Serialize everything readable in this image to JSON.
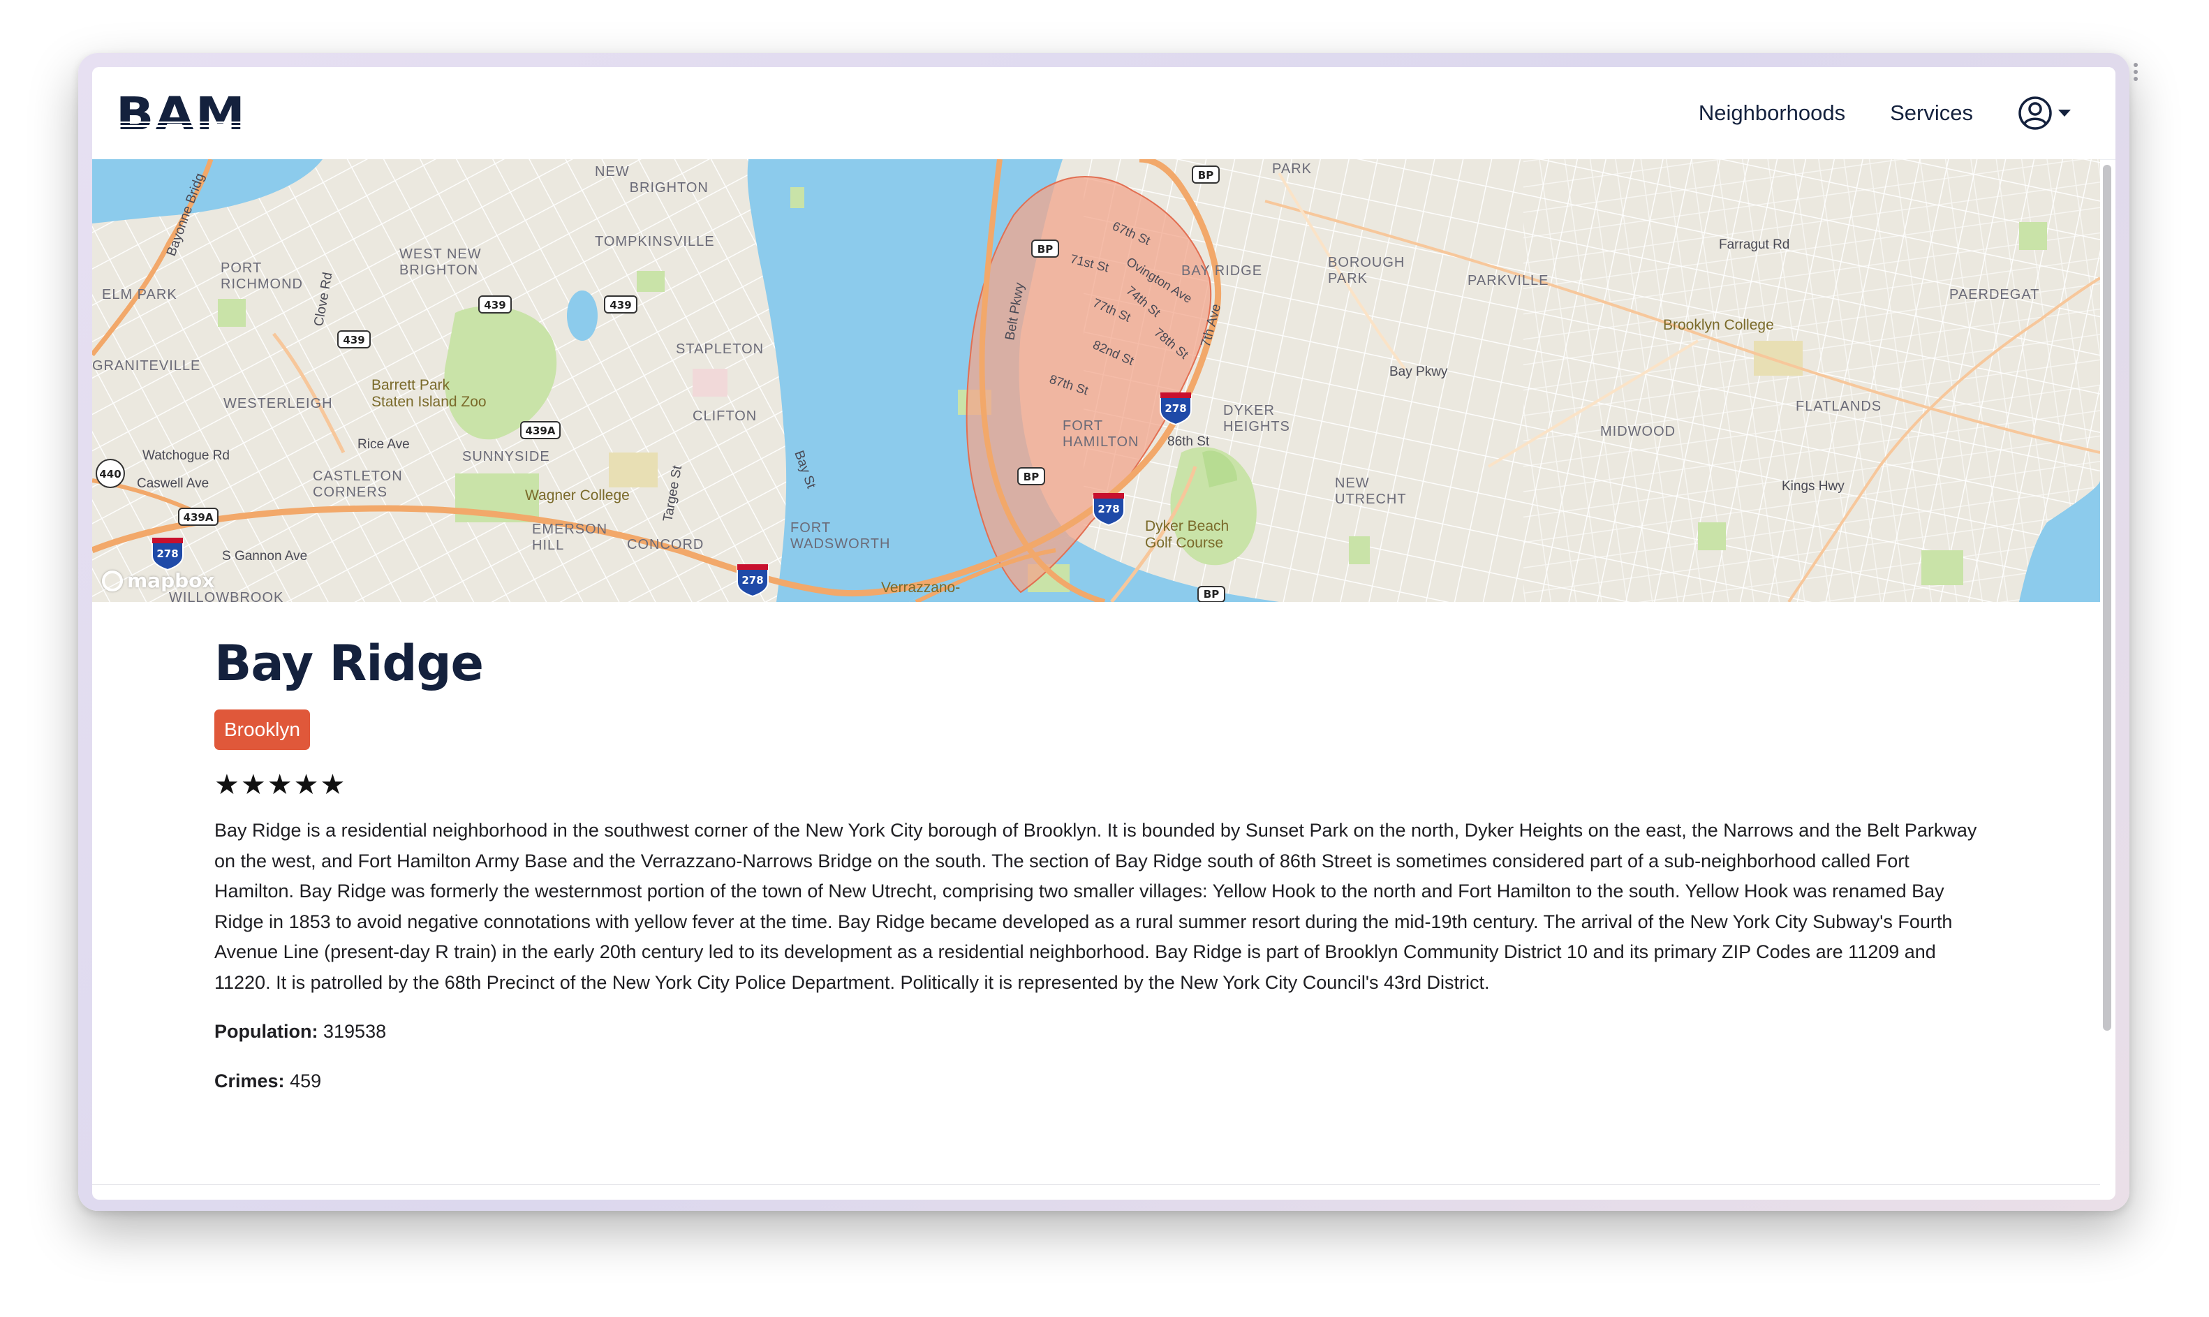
{
  "brand": {
    "logo_text": "BAM",
    "color": "#14213d"
  },
  "nav": {
    "links": [
      "Neighborhoods",
      "Services"
    ],
    "user_icon": "user-circle-icon",
    "caret_icon": "caret-down-icon"
  },
  "map": {
    "attribution": "mapbox",
    "highlight_color": "#f2a58c",
    "labels": {
      "new_brighton": "NEW\nBRIGHTON",
      "tompkinsville": "TOMPKINSVILLE",
      "port_richmond": "PORT\nRICHMOND",
      "west_new_brighton": "WEST NEW\nBRIGHTON",
      "elm_park": "ELM PARK",
      "graniteville": "GRANITEVILLE",
      "westerleigh": "WESTERLEIGH",
      "barrett_park": "Barrett Park\nStaten Island Zoo",
      "stapleton": "STAPLETON",
      "clifton": "CLIFTON",
      "sunnyside": "SUNNYSIDE",
      "castleton": "CASTLETON\nCORNERS",
      "wagner": "Wagner College",
      "emerson_hill": "EMERSON\nHILL",
      "concord": "CONCORD",
      "fort_wadsworth": "FORT\nWADSWORTH",
      "verrazzano": "Verrazzano-",
      "bay_ridge": "BAY RIDGE",
      "fort_hamilton": "FORT\nHAMILTON",
      "borough_park": "BOROUGH\nPARK",
      "parkville": "PARKVILLE",
      "dyker_heights": "DYKER\nHEIGHTS",
      "dyker_beach": "Dyker Beach\nGolf Course",
      "new_utrecht": "NEW\nUTRECHT",
      "midwood": "MIDWOOD",
      "flatlands": "FLATLANDS",
      "brooklyn_college": "Brooklyn College",
      "paerdegat": "PAERDEGAT",
      "park": "PARK",
      "watchogue": "Watchogue Rd",
      "caswell": "Caswell Ave",
      "rice_ave": "Rice Ave",
      "s_gannon": "S Gannon Ave",
      "clove_rd": "Clove Rd",
      "bayonne": "Bayonne Bridg",
      "targee": "Targee St",
      "bay_st": "Bay St",
      "belt_pkwy": "Belt Pkwy",
      "seventh_ave": "7th Ave",
      "eighty_sixth": "86th St",
      "kings_hwy": "Kings Hwy",
      "farragut": "Farragut Rd",
      "bay_pkwy": "Bay Pkwy",
      "willowbrook": "WILLOWBROOK"
    },
    "shields": {
      "i278": "278",
      "r439": "439",
      "r439a": "439A",
      "r440": "440",
      "bp": "BP"
    }
  },
  "neighborhood": {
    "name": "Bay Ridge",
    "borough": "Brooklyn",
    "rating": 5,
    "stars": "★★★★★",
    "description": "Bay Ridge is a residential neighborhood in the southwest corner of the New York City borough of Brooklyn. It is bounded by Sunset Park on the north, Dyker Heights on the east, the Narrows and the Belt Parkway on the west, and Fort Hamilton Army Base and the Verrazzano-Narrows Bridge on the south. The section of Bay Ridge south of 86th Street is sometimes considered part of a sub-neighborhood called Fort Hamilton. Bay Ridge was formerly the westernmost portion of the town of New Utrecht, comprising two smaller villages: Yellow Hook to the north and Fort Hamilton to the south. Yellow Hook was renamed Bay Ridge in 1853 to avoid negative connotations with yellow fever at the time. Bay Ridge became developed as a rural summer resort during the mid-19th century. The arrival of the New York City Subway's Fourth Avenue Line (present-day R train) in the early 20th century led to its development as a residential neighborhood. Bay Ridge is part of Brooklyn Community District 10 and its primary ZIP Codes are 11209 and 11220. It is patrolled by the 68th Precinct of the New York City Police Department. Politically it is represented by the New York City Council's 43rd District.",
    "population_label": "Population:",
    "population": "319538",
    "crimes_label": "Crimes:",
    "crimes": "459"
  },
  "colors": {
    "badge": "#e0583a",
    "water": "#8ccbec",
    "park": "#c9e3a8",
    "highway": "#f2a86a"
  }
}
